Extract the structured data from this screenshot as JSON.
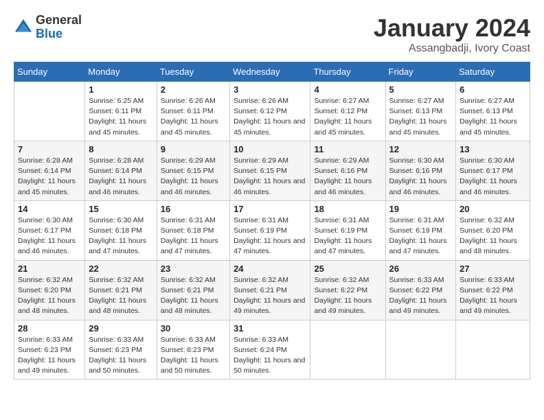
{
  "header": {
    "logo_general": "General",
    "logo_blue": "Blue",
    "month": "January 2024",
    "location": "Assangbadji, Ivory Coast"
  },
  "weekdays": [
    "Sunday",
    "Monday",
    "Tuesday",
    "Wednesday",
    "Thursday",
    "Friday",
    "Saturday"
  ],
  "weeks": [
    [
      {
        "day": "",
        "sunrise": "",
        "sunset": "",
        "daylight": ""
      },
      {
        "day": "1",
        "sunrise": "Sunrise: 6:25 AM",
        "sunset": "Sunset: 6:11 PM",
        "daylight": "Daylight: 11 hours and 45 minutes."
      },
      {
        "day": "2",
        "sunrise": "Sunrise: 6:26 AM",
        "sunset": "Sunset: 6:11 PM",
        "daylight": "Daylight: 11 hours and 45 minutes."
      },
      {
        "day": "3",
        "sunrise": "Sunrise: 6:26 AM",
        "sunset": "Sunset: 6:12 PM",
        "daylight": "Daylight: 11 hours and 45 minutes."
      },
      {
        "day": "4",
        "sunrise": "Sunrise: 6:27 AM",
        "sunset": "Sunset: 6:12 PM",
        "daylight": "Daylight: 11 hours and 45 minutes."
      },
      {
        "day": "5",
        "sunrise": "Sunrise: 6:27 AM",
        "sunset": "Sunset: 6:13 PM",
        "daylight": "Daylight: 11 hours and 45 minutes."
      },
      {
        "day": "6",
        "sunrise": "Sunrise: 6:27 AM",
        "sunset": "Sunset: 6:13 PM",
        "daylight": "Daylight: 11 hours and 45 minutes."
      }
    ],
    [
      {
        "day": "7",
        "sunrise": "Sunrise: 6:28 AM",
        "sunset": "Sunset: 6:14 PM",
        "daylight": "Daylight: 11 hours and 45 minutes."
      },
      {
        "day": "8",
        "sunrise": "Sunrise: 6:28 AM",
        "sunset": "Sunset: 6:14 PM",
        "daylight": "Daylight: 11 hours and 46 minutes."
      },
      {
        "day": "9",
        "sunrise": "Sunrise: 6:29 AM",
        "sunset": "Sunset: 6:15 PM",
        "daylight": "Daylight: 11 hours and 46 minutes."
      },
      {
        "day": "10",
        "sunrise": "Sunrise: 6:29 AM",
        "sunset": "Sunset: 6:15 PM",
        "daylight": "Daylight: 11 hours and 46 minutes."
      },
      {
        "day": "11",
        "sunrise": "Sunrise: 6:29 AM",
        "sunset": "Sunset: 6:16 PM",
        "daylight": "Daylight: 11 hours and 46 minutes."
      },
      {
        "day": "12",
        "sunrise": "Sunrise: 6:30 AM",
        "sunset": "Sunset: 6:16 PM",
        "daylight": "Daylight: 11 hours and 46 minutes."
      },
      {
        "day": "13",
        "sunrise": "Sunrise: 6:30 AM",
        "sunset": "Sunset: 6:17 PM",
        "daylight": "Daylight: 11 hours and 46 minutes."
      }
    ],
    [
      {
        "day": "14",
        "sunrise": "Sunrise: 6:30 AM",
        "sunset": "Sunset: 6:17 PM",
        "daylight": "Daylight: 11 hours and 46 minutes."
      },
      {
        "day": "15",
        "sunrise": "Sunrise: 6:30 AM",
        "sunset": "Sunset: 6:18 PM",
        "daylight": "Daylight: 11 hours and 47 minutes."
      },
      {
        "day": "16",
        "sunrise": "Sunrise: 6:31 AM",
        "sunset": "Sunset: 6:18 PM",
        "daylight": "Daylight: 11 hours and 47 minutes."
      },
      {
        "day": "17",
        "sunrise": "Sunrise: 6:31 AM",
        "sunset": "Sunset: 6:19 PM",
        "daylight": "Daylight: 11 hours and 47 minutes."
      },
      {
        "day": "18",
        "sunrise": "Sunrise: 6:31 AM",
        "sunset": "Sunset: 6:19 PM",
        "daylight": "Daylight: 11 hours and 47 minutes."
      },
      {
        "day": "19",
        "sunrise": "Sunrise: 6:31 AM",
        "sunset": "Sunset: 6:19 PM",
        "daylight": "Daylight: 11 hours and 47 minutes."
      },
      {
        "day": "20",
        "sunrise": "Sunrise: 6:32 AM",
        "sunset": "Sunset: 6:20 PM",
        "daylight": "Daylight: 11 hours and 48 minutes."
      }
    ],
    [
      {
        "day": "21",
        "sunrise": "Sunrise: 6:32 AM",
        "sunset": "Sunset: 6:20 PM",
        "daylight": "Daylight: 11 hours and 48 minutes."
      },
      {
        "day": "22",
        "sunrise": "Sunrise: 6:32 AM",
        "sunset": "Sunset: 6:21 PM",
        "daylight": "Daylight: 11 hours and 48 minutes."
      },
      {
        "day": "23",
        "sunrise": "Sunrise: 6:32 AM",
        "sunset": "Sunset: 6:21 PM",
        "daylight": "Daylight: 11 hours and 48 minutes."
      },
      {
        "day": "24",
        "sunrise": "Sunrise: 6:32 AM",
        "sunset": "Sunset: 6:21 PM",
        "daylight": "Daylight: 11 hours and 49 minutes."
      },
      {
        "day": "25",
        "sunrise": "Sunrise: 6:32 AM",
        "sunset": "Sunset: 6:22 PM",
        "daylight": "Daylight: 11 hours and 49 minutes."
      },
      {
        "day": "26",
        "sunrise": "Sunrise: 6:33 AM",
        "sunset": "Sunset: 6:22 PM",
        "daylight": "Daylight: 11 hours and 49 minutes."
      },
      {
        "day": "27",
        "sunrise": "Sunrise: 6:33 AM",
        "sunset": "Sunset: 6:22 PM",
        "daylight": "Daylight: 11 hours and 49 minutes."
      }
    ],
    [
      {
        "day": "28",
        "sunrise": "Sunrise: 6:33 AM",
        "sunset": "Sunset: 6:23 PM",
        "daylight": "Daylight: 11 hours and 49 minutes."
      },
      {
        "day": "29",
        "sunrise": "Sunrise: 6:33 AM",
        "sunset": "Sunset: 6:23 PM",
        "daylight": "Daylight: 11 hours and 50 minutes."
      },
      {
        "day": "30",
        "sunrise": "Sunrise: 6:33 AM",
        "sunset": "Sunset: 6:23 PM",
        "daylight": "Daylight: 11 hours and 50 minutes."
      },
      {
        "day": "31",
        "sunrise": "Sunrise: 6:33 AM",
        "sunset": "Sunset: 6:24 PM",
        "daylight": "Daylight: 11 hours and 50 minutes."
      },
      {
        "day": "",
        "sunrise": "",
        "sunset": "",
        "daylight": ""
      },
      {
        "day": "",
        "sunrise": "",
        "sunset": "",
        "daylight": ""
      },
      {
        "day": "",
        "sunrise": "",
        "sunset": "",
        "daylight": ""
      }
    ]
  ]
}
